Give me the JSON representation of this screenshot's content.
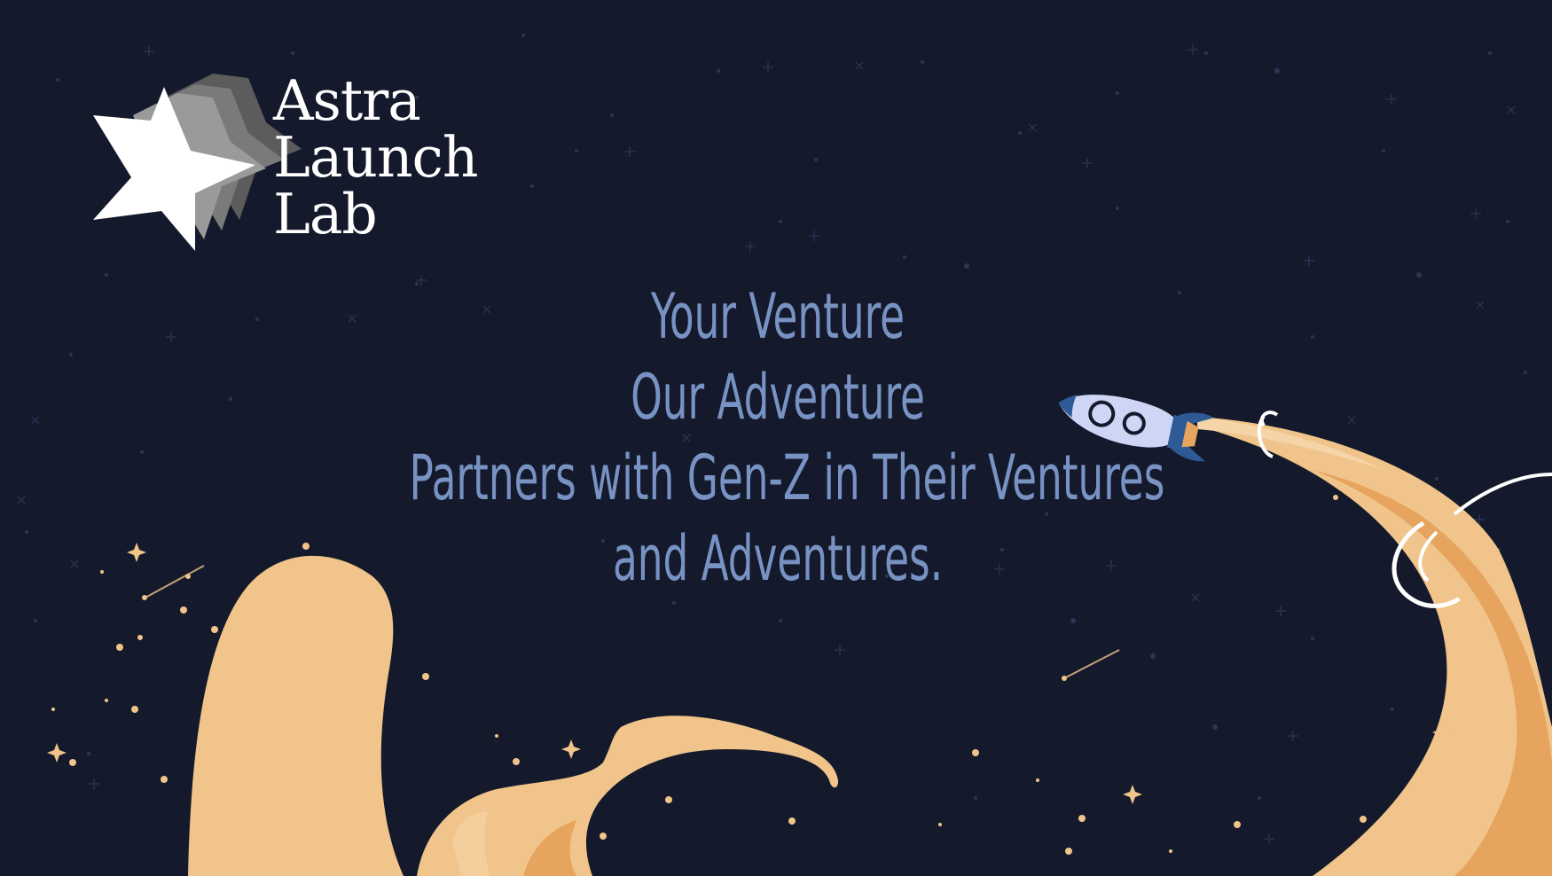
{
  "logo": {
    "line1": "Astra",
    "line2": "Launch",
    "line3": "Lab",
    "icon": "star-icon"
  },
  "headline": {
    "line1": "Your Venture",
    "line2": "Our Adventure",
    "line3": "Partners with Gen-Z in Their Ventures",
    "line4": "and Adventures."
  },
  "colors": {
    "background": "#141a2b",
    "headline": "#7892c4",
    "sand": "#f0c48a",
    "sand_dark": "#e6a45e",
    "rocket_body": "#cfd5f5",
    "rocket_fin": "#2e5a96",
    "logo": "#ffffff"
  },
  "illustration": {
    "rocket_icon": "rocket-icon",
    "flame_icon": "rocket-exhaust-trail"
  }
}
